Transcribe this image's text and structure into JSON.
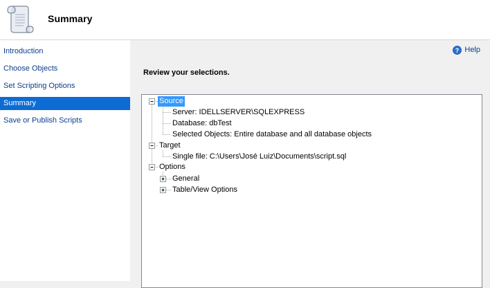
{
  "header": {
    "title": "Summary",
    "icon": "scroll-icon"
  },
  "sidebar": {
    "items": [
      {
        "label": "Introduction",
        "active": false
      },
      {
        "label": "Choose Objects",
        "active": false
      },
      {
        "label": "Set Scripting Options",
        "active": false
      },
      {
        "label": "Summary",
        "active": true
      },
      {
        "label": "Save or Publish Scripts",
        "active": false
      }
    ]
  },
  "help": {
    "label": "Help",
    "icon": "help-icon"
  },
  "main": {
    "heading": "Review your selections."
  },
  "tree": {
    "source": {
      "label": "Source",
      "state": "expanded",
      "children": [
        "Server: IDELLSERVER\\SQLEXPRESS",
        "Database: dbTest",
        "Selected Objects: Entire database and all database objects"
      ]
    },
    "target": {
      "label": "Target",
      "state": "expanded",
      "children": [
        "Single file: C:\\Users\\José Luiz\\Documents\\script.sql"
      ]
    },
    "options": {
      "label": "Options",
      "state": "expanded",
      "children": [
        {
          "label": "General",
          "state": "collapsed"
        },
        {
          "label": "Table/View Options",
          "state": "collapsed"
        }
      ]
    }
  },
  "colors": {
    "selection": "#0c6cd4",
    "tree_selection": "#3399ff",
    "link": "#0b3d8f"
  }
}
